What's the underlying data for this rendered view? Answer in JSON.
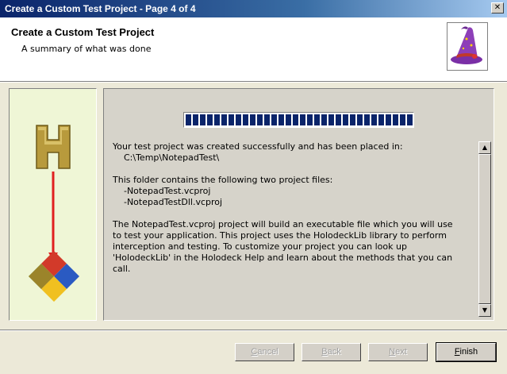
{
  "window": {
    "title": "Create a Custom Test Project - Page 4 of 4",
    "close_glyph": "✕"
  },
  "header": {
    "title": "Create a Custom Test Project",
    "subtitle": "A summary of what was done",
    "icon": "wizard-hat-icon"
  },
  "side_graphic": {
    "top_icon": "holodeck-h-logo",
    "arrow": "red-down-arrow",
    "bottom_icon": "visual-studio-logo",
    "arrow_color": "#e02020"
  },
  "progress": {
    "fraction": 1.0,
    "color": "#0a246a"
  },
  "summary": {
    "line1": "Your test project was created successfully and has been placed in:",
    "line2": "    C:\\Temp\\NotepadTest\\",
    "line3": "This folder contains the following two project files:",
    "line4": "    -NotepadTest.vcproj",
    "line5": "    -NotepadTestDll.vcproj",
    "line6": "The NotepadTest.vcproj project will build an executable file which you will use",
    "line7": "to test your application. This project uses the HolodeckLib library to perform",
    "line8": "interception and testing. To customize your project you can look up",
    "line9": "'HolodeckLib' in the Holodeck Help and learn about the methods that you can",
    "line10": "call."
  },
  "buttons": {
    "cancel_first": "C",
    "cancel_rest": "ancel",
    "back_first": "B",
    "back_rest": "ack",
    "next_first": "N",
    "next_rest": "ext",
    "finish_first": "F",
    "finish_rest": "inish"
  },
  "scrollbar": {
    "up_glyph": "▲",
    "down_glyph": "▼"
  }
}
